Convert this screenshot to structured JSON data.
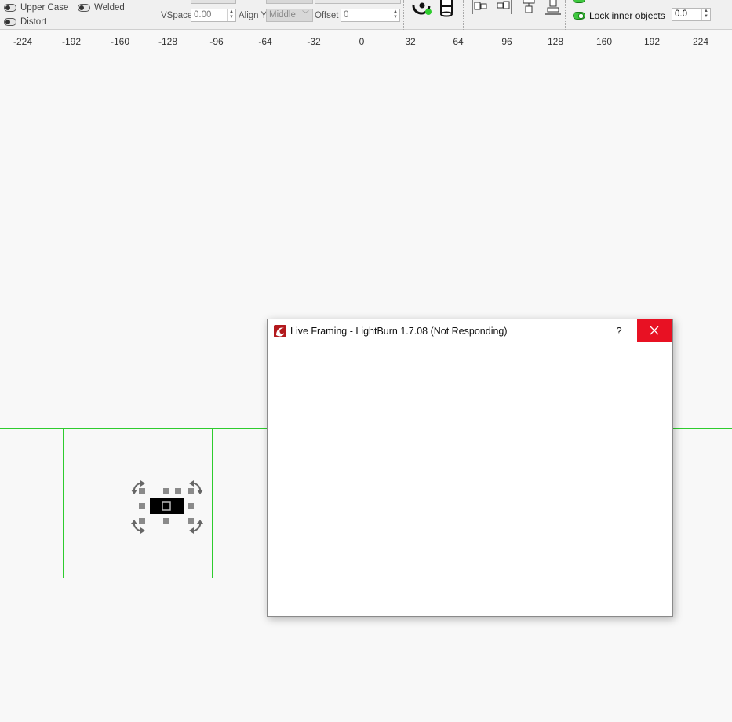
{
  "toolbar": {
    "toggles": {
      "upper_case": "Upper Case",
      "welded": "Welded",
      "distort": "Distort"
    },
    "vspace": {
      "label": "VSpace",
      "value": "0.00"
    },
    "align_y": {
      "label": "Align Y",
      "value": "Middle"
    },
    "offset": {
      "label": "Offset",
      "value": "0"
    },
    "lock_inner_objects": "Lock inner objects",
    "padding_value": "0.0"
  },
  "ruler": {
    "ticks": [
      "-224",
      "-192",
      "-160",
      "-128",
      "-96",
      "-64",
      "-32",
      "0",
      "32",
      "64",
      "96",
      "128",
      "160",
      "192",
      "224"
    ]
  },
  "dialog": {
    "title": "Live Framing - LightBurn 1.7.08 (Not Responding)",
    "help_label": "?"
  },
  "colors": {
    "grid_line": "#2ecc2e",
    "close_button": "#e81123",
    "app_icon": "#b3191d"
  }
}
